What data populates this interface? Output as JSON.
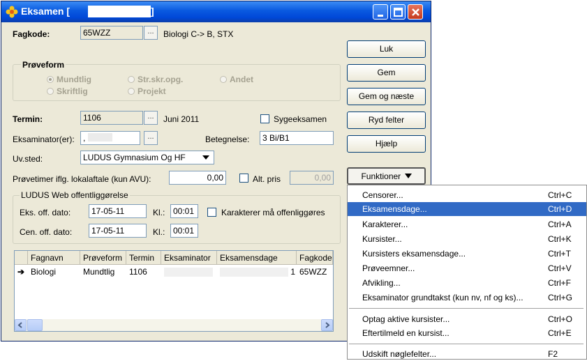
{
  "window": {
    "title": "Eksamen [",
    "title_end": "]",
    "controls": [
      "minimize-icon",
      "maximize-icon",
      "close-icon"
    ]
  },
  "form": {
    "fagkode_label": "Fagkode:",
    "fagkode_value": "65WZZ",
    "dots": "...",
    "fagkode_desc": "Biologi C-> B, STX",
    "proveform_label": "Prøveform",
    "proveform_options": [
      "Mundtlig",
      "Str.skr.opg.",
      "Andet",
      "Skriftlig",
      "Projekt"
    ],
    "proveform_selected": "Mundtlig",
    "termin_label": "Termin:",
    "termin_value": "1106",
    "termin_desc": "Juni 2011",
    "sygeeksamen_label": "Sygeeksamen",
    "eksaminator_label": "Eksaminator(er):",
    "eksaminator_value": ",",
    "betegnelse_label": "Betegnelse:",
    "betegnelse_value": "3 Bi/B1",
    "uvsted_label": "Uv.sted:",
    "uvsted_value": "LUDUS Gymnasium Og HF",
    "provetimer_label": "Prøvetimer iflg. lokalaftale (kun AVU):",
    "provetimer_value": "0,00",
    "altpris_label": "Alt. pris",
    "altpris_value": "0,00",
    "web_group_label": "LUDUS Web offentliggørelse",
    "eks_off_label": "Eks. off. dato:",
    "eks_off_date": "17-05-11",
    "kl_label": "Kl.:",
    "eks_off_time": "00:01",
    "karakterer_label": "Karakterer må offenliggøres",
    "cen_off_label": "Cen. off. dato:",
    "cen_off_date": "17-05-11",
    "cen_off_time": "00:01"
  },
  "buttons": {
    "luk": "Luk",
    "gem": "Gem",
    "gem_naeste": "Gem og næste",
    "ryd": "Ryd felter",
    "hjaelp": "Hjælp",
    "funktioner": "Funktioner"
  },
  "grid": {
    "columns": [
      "Fagnavn",
      "Prøveform",
      "Termin",
      "Eksaminator",
      "Eksamensdage",
      "Fagkode"
    ],
    "rows": [
      {
        "marker": "➔",
        "Fagnavn": "Biologi",
        "Proveform": "Mundtlig",
        "Termin": "1106",
        "Eksaminator": "",
        "Eksamensdage": "1",
        "Fagkode": "65WZZ"
      }
    ]
  },
  "menu": {
    "items": [
      {
        "label": "Censorer...",
        "shortcut": "Ctrl+C"
      },
      {
        "label": "Eksamensdage...",
        "shortcut": "Ctrl+D",
        "selected": true
      },
      {
        "label": "Karakterer...",
        "shortcut": "Ctrl+A"
      },
      {
        "label": "Kursister...",
        "shortcut": "Ctrl+K"
      },
      {
        "label": "Kursisters eksamensdage...",
        "shortcut": "Ctrl+T"
      },
      {
        "label": "Prøveemner...",
        "shortcut": "Ctrl+V"
      },
      {
        "label": "Afvikling...",
        "shortcut": "Ctrl+F"
      },
      {
        "label": "Eksaminator grundtakst (kun nv, nf og ks)...",
        "shortcut": "Ctrl+G"
      },
      {
        "label": "Optag aktive kursister...",
        "shortcut": "Ctrl+O"
      },
      {
        "label": "Eftertilmeld en kursist...",
        "shortcut": "Ctrl+E"
      },
      {
        "label": "Udskift nøglefelter...",
        "shortcut": "F2"
      }
    ]
  },
  "colors": {
    "titlebar": "#0a5ae0",
    "window_bg": "#ece9d8",
    "menu_highlight": "#316ac5"
  }
}
